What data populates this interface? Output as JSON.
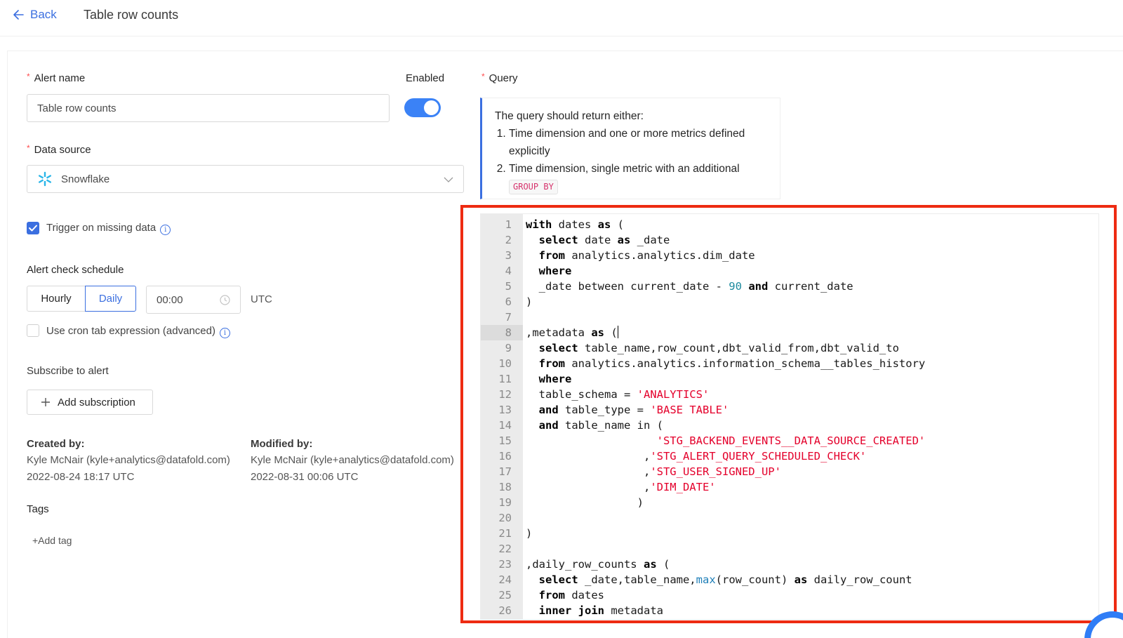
{
  "header": {
    "back_label": "Back",
    "title": "Table row counts"
  },
  "form": {
    "alert_name_label": "Alert name",
    "alert_name_value": "Table row counts",
    "enabled_label": "Enabled",
    "enabled": true,
    "data_source_label": "Data source",
    "data_source_value": "Snowflake",
    "trigger_label": "Trigger on missing data",
    "trigger_checked": true,
    "schedule_label": "Alert check schedule",
    "schedule_hourly": "Hourly",
    "schedule_daily": "Daily",
    "schedule_selected": "Daily",
    "time_value": "00:00",
    "timezone": "UTC",
    "cron_label": "Use cron tab expression (advanced)",
    "cron_checked": false,
    "subscribe_label": "Subscribe to alert",
    "add_subscription": "Add subscription",
    "created_by_label": "Created by:",
    "created_by_user": "Kyle McNair (kyle+analytics@datafold.com)",
    "created_at": "2022-08-24 18:17 UTC",
    "modified_by_label": "Modified by:",
    "modified_by_user": "Kyle McNair (kyle+analytics@datafold.com)",
    "modified_at": "2022-08-31 00:06 UTC",
    "tags_label": "Tags",
    "add_tag": "+Add tag"
  },
  "query": {
    "label": "Query",
    "hint_intro": "The query should return either:",
    "hint_items": [
      "Time dimension and one or more metrics defined explicitly",
      "Time dimension, single metric with an additional"
    ],
    "hint_code": "GROUP BY",
    "active_line": 8,
    "lines": [
      [
        [
          "k",
          "with"
        ],
        [
          "t",
          " dates "
        ],
        [
          "k",
          "as"
        ],
        [
          "t",
          " ("
        ]
      ],
      [
        [
          "t",
          "  "
        ],
        [
          "k",
          "select"
        ],
        [
          "t",
          " date "
        ],
        [
          "k",
          "as"
        ],
        [
          "t",
          " _date"
        ]
      ],
      [
        [
          "t",
          "  "
        ],
        [
          "k",
          "from"
        ],
        [
          "t",
          " analytics.analytics.dim_date"
        ]
      ],
      [
        [
          "t",
          "  "
        ],
        [
          "k",
          "where"
        ]
      ],
      [
        [
          "t",
          "  _date between current_date - "
        ],
        [
          "n",
          "90"
        ],
        [
          "t",
          " "
        ],
        [
          "k",
          "and"
        ],
        [
          "t",
          " current_date"
        ]
      ],
      [
        [
          "t",
          ")"
        ]
      ],
      [
        [
          "t",
          ""
        ]
      ],
      [
        [
          "t",
          ",metadata "
        ],
        [
          "k",
          "as"
        ],
        [
          "t",
          " ("
        ],
        [
          "c",
          ""
        ]
      ],
      [
        [
          "t",
          "  "
        ],
        [
          "k",
          "select"
        ],
        [
          "t",
          " table_name,row_count,dbt_valid_from,dbt_valid_to"
        ]
      ],
      [
        [
          "t",
          "  "
        ],
        [
          "k",
          "from"
        ],
        [
          "t",
          " analytics.analytics.information_schema__tables_history"
        ]
      ],
      [
        [
          "t",
          "  "
        ],
        [
          "k",
          "where"
        ]
      ],
      [
        [
          "t",
          "  table_schema = "
        ],
        [
          "s",
          "'ANALYTICS'"
        ]
      ],
      [
        [
          "t",
          "  "
        ],
        [
          "k",
          "and"
        ],
        [
          "t",
          " table_type = "
        ],
        [
          "s",
          "'BASE TABLE'"
        ]
      ],
      [
        [
          "t",
          "  "
        ],
        [
          "k",
          "and"
        ],
        [
          "t",
          " table_name in ("
        ]
      ],
      [
        [
          "t",
          "                    "
        ],
        [
          "s",
          "'STG_BACKEND_EVENTS__DATA_SOURCE_CREATED'"
        ]
      ],
      [
        [
          "t",
          "                  ,"
        ],
        [
          "s",
          "'STG_ALERT_QUERY_SCHEDULED_CHECK'"
        ]
      ],
      [
        [
          "t",
          "                  ,"
        ],
        [
          "s",
          "'STG_USER_SIGNED_UP'"
        ]
      ],
      [
        [
          "t",
          "                  ,"
        ],
        [
          "s",
          "'DIM_DATE'"
        ]
      ],
      [
        [
          "t",
          "                 )"
        ]
      ],
      [
        [
          "t",
          ""
        ]
      ],
      [
        [
          "t",
          ")"
        ]
      ],
      [
        [
          "t",
          ""
        ]
      ],
      [
        [
          "t",
          ",daily_row_counts "
        ],
        [
          "k",
          "as"
        ],
        [
          "t",
          " ("
        ]
      ],
      [
        [
          "t",
          "  "
        ],
        [
          "k",
          "select"
        ],
        [
          "t",
          " _date,table_name,"
        ],
        [
          "f",
          "max"
        ],
        [
          "t",
          "(row_count) "
        ],
        [
          "k",
          "as"
        ],
        [
          "t",
          " daily_row_count"
        ]
      ],
      [
        [
          "t",
          "  "
        ],
        [
          "k",
          "from"
        ],
        [
          "t",
          " dates"
        ]
      ],
      [
        [
          "t",
          "  "
        ],
        [
          "k",
          "inner join"
        ],
        [
          "t",
          " metadata"
        ]
      ]
    ]
  }
}
